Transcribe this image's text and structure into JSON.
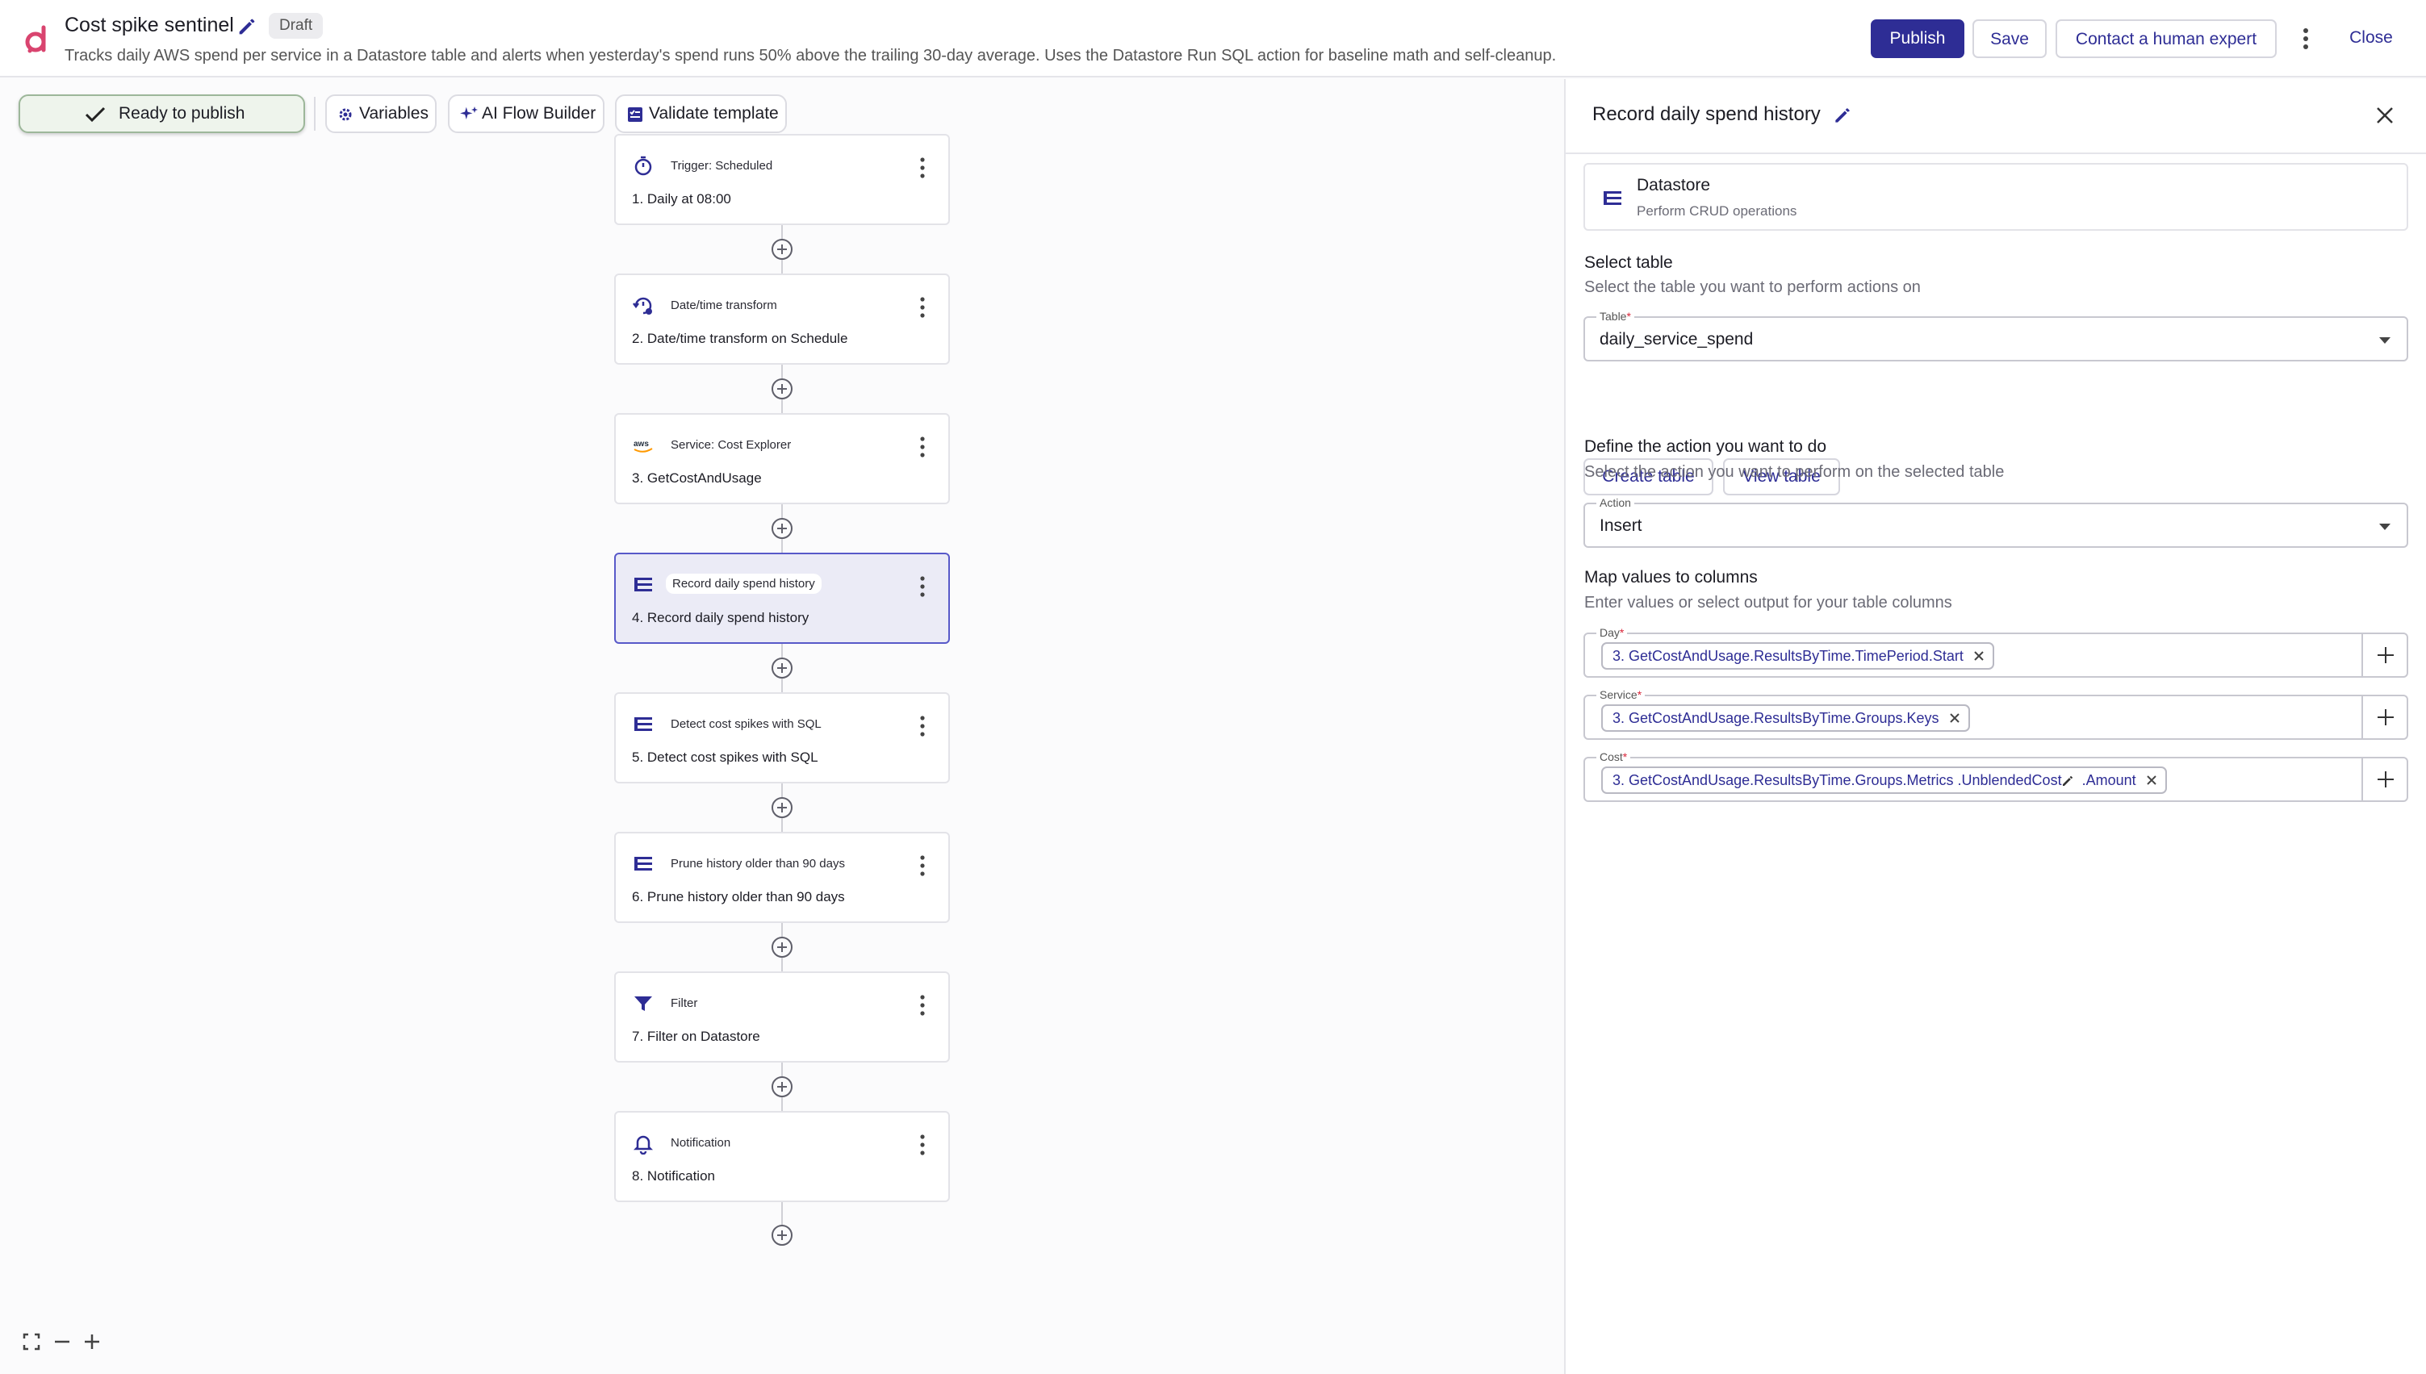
{
  "header": {
    "title": "Cost spike sentinel",
    "status_badge": "Draft",
    "description": "Tracks daily AWS spend per service in a Datastore table and alerts when yesterday's spend runs 50% above the trailing 30-day average. Uses the Datastore Run SQL action for baseline math and self-cleanup.",
    "publish_label": "Publish",
    "save_label": "Save",
    "contact_label": "Contact a human expert",
    "close_label": "Close",
    "brand_color": "#d9446f",
    "accent_color": "#2e2d95"
  },
  "toolbar": {
    "ready_label": "Ready to publish",
    "variables_label": "Variables",
    "ai_label": "AI Flow Builder",
    "validate_label": "Validate template"
  },
  "flow": {
    "nodes": [
      {
        "type": "Trigger: Scheduled",
        "label": "1. Daily at 08:00",
        "icon": "stopwatch-icon",
        "selected": false
      },
      {
        "type": "Date/time transform",
        "label": "2. Date/time transform on Schedule",
        "icon": "clock-transform-icon",
        "selected": false
      },
      {
        "type": "Service: Cost Explorer",
        "label": "3. GetCostAndUsage",
        "icon": "aws-icon",
        "selected": false
      },
      {
        "type": "Record daily spend history",
        "label": "4. Record daily spend history",
        "icon": "datastore-icon",
        "selected": true
      },
      {
        "type": "Detect cost spikes with SQL",
        "label": "5. Detect cost spikes with SQL",
        "icon": "datastore-icon",
        "selected": false
      },
      {
        "type": "Prune history older than 90 days",
        "label": "6. Prune history older than 90 days",
        "icon": "datastore-icon",
        "selected": false
      },
      {
        "type": "Filter",
        "label": "7. Filter on Datastore",
        "icon": "filter-icon",
        "selected": false
      },
      {
        "type": "Notification",
        "label": "8. Notification",
        "icon": "bell-icon",
        "selected": false
      }
    ]
  },
  "panel": {
    "title": "Record daily spend history",
    "service": {
      "name": "Datastore",
      "description": "Perform CRUD operations"
    },
    "select_table": {
      "heading": "Select table",
      "description": "Select the table you want to perform actions on",
      "field_label": "Table",
      "value": "daily_service_spend",
      "create_label": "Create table",
      "view_label": "View table"
    },
    "action": {
      "heading": "Define the action you want to do",
      "description": "Select the action you want to perform on the selected table",
      "field_label": "Action",
      "value": "Insert"
    },
    "mapping": {
      "heading": "Map values to columns",
      "description": "Enter values or select output for your table columns",
      "columns": [
        {
          "label": "Day",
          "value": "3. GetCostAndUsage.ResultsByTime.TimePeriod.Start"
        },
        {
          "label": "Service",
          "value": "3. GetCostAndUsage.ResultsByTime.Groups.Keys"
        },
        {
          "label": "Cost",
          "value_part1": "3. GetCostAndUsage.ResultsByTime.Groups.Metrics .UnblendedCost",
          "value_part2": " .Amount"
        }
      ]
    }
  }
}
